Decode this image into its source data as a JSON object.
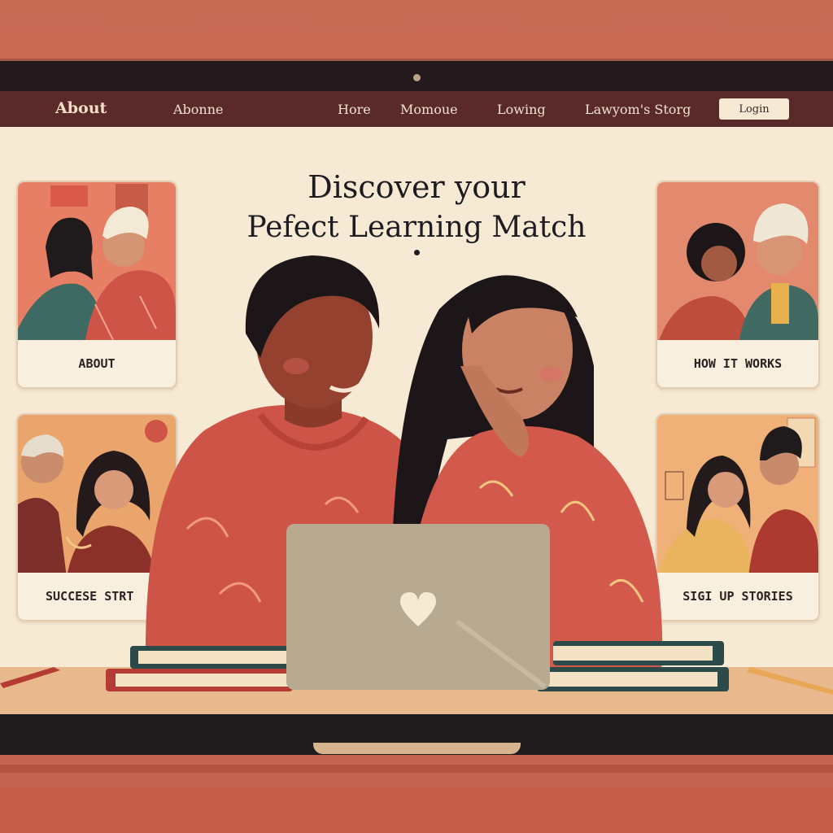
{
  "nav": {
    "brand": "About",
    "items": [
      "Abonne",
      "Hore",
      "Momoue",
      "Lowing",
      "Lawyom's Storg"
    ],
    "login": "Login"
  },
  "hero": {
    "line1": "Discover your",
    "line2": "Pefect Learning Match"
  },
  "cards": {
    "about": "ABOUT",
    "how_it_works": "HOW IT WORKS",
    "success_stories": "SUCCESE STRT",
    "sign_up_stories": "SIGI UP STORIES"
  },
  "icons": {
    "laptop_logo": "heart-icon"
  },
  "colors": {
    "navbar": "#5a2a2b",
    "screen_bg": "#f7ead4",
    "accent_red": "#cf5448",
    "login_bg": "#f6ead4"
  }
}
